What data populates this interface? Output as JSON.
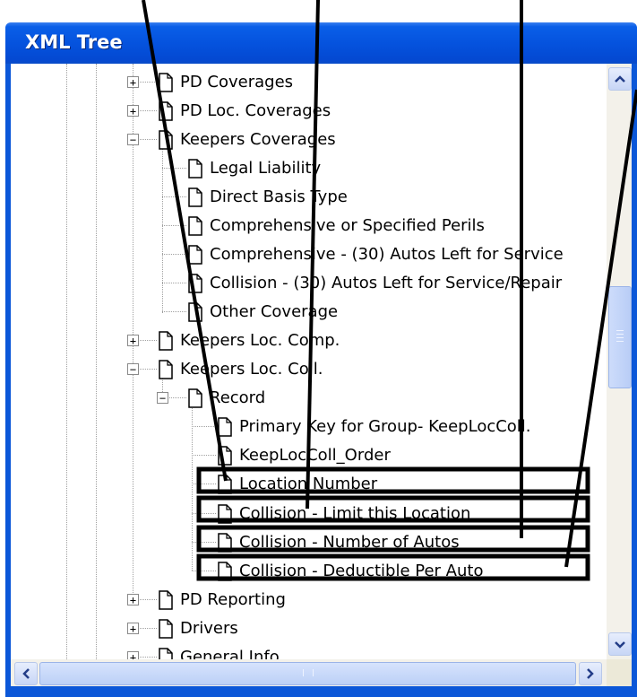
{
  "window": {
    "title": "XML Tree"
  },
  "tree": {
    "items": [
      {
        "label": "PD Coverages",
        "expander": "+"
      },
      {
        "label": "PD Loc. Coverages",
        "expander": "+"
      },
      {
        "label": "Keepers Coverages",
        "expander": "−"
      },
      {
        "label": "Legal Liability",
        "expander": ""
      },
      {
        "label": "Direct Basis Type",
        "expander": ""
      },
      {
        "label": "Comprehensive or Specified Perils",
        "expander": ""
      },
      {
        "label": "Comprehensive - (30) Autos Left for Service",
        "expander": ""
      },
      {
        "label": "Collision - (30) Autos Left for Service/Repair",
        "expander": ""
      },
      {
        "label": "Other Coverage",
        "expander": ""
      },
      {
        "label": "Keepers Loc. Comp.",
        "expander": "+"
      },
      {
        "label": "Keepers Loc. Coll.",
        "expander": "−"
      },
      {
        "label": "Record",
        "expander": "−"
      },
      {
        "label": "Primary Key for Group- KeepLocColl.",
        "expander": ""
      },
      {
        "label": "KeepLocColl_Order",
        "expander": ""
      },
      {
        "label": "Location Number",
        "expander": ""
      },
      {
        "label": "Collision - Limit this Location",
        "expander": ""
      },
      {
        "label": "Collision - Number of Autos",
        "expander": ""
      },
      {
        "label": "Collision - Deductible Per Auto",
        "expander": ""
      },
      {
        "label": "PD Reporting",
        "expander": "+"
      },
      {
        "label": "Drivers",
        "expander": "+"
      },
      {
        "label": "General Info",
        "expander": "+"
      }
    ]
  },
  "scrollbars": {
    "vertical": {
      "up_icon": "chevron-up-icon",
      "down_icon": "chevron-down-icon"
    },
    "horizontal": {
      "left_icon": "chevron-left-icon",
      "right_icon": "chevron-right-icon"
    }
  },
  "colors": {
    "titlebar": "#0553de",
    "highlight_box": "#000000"
  }
}
